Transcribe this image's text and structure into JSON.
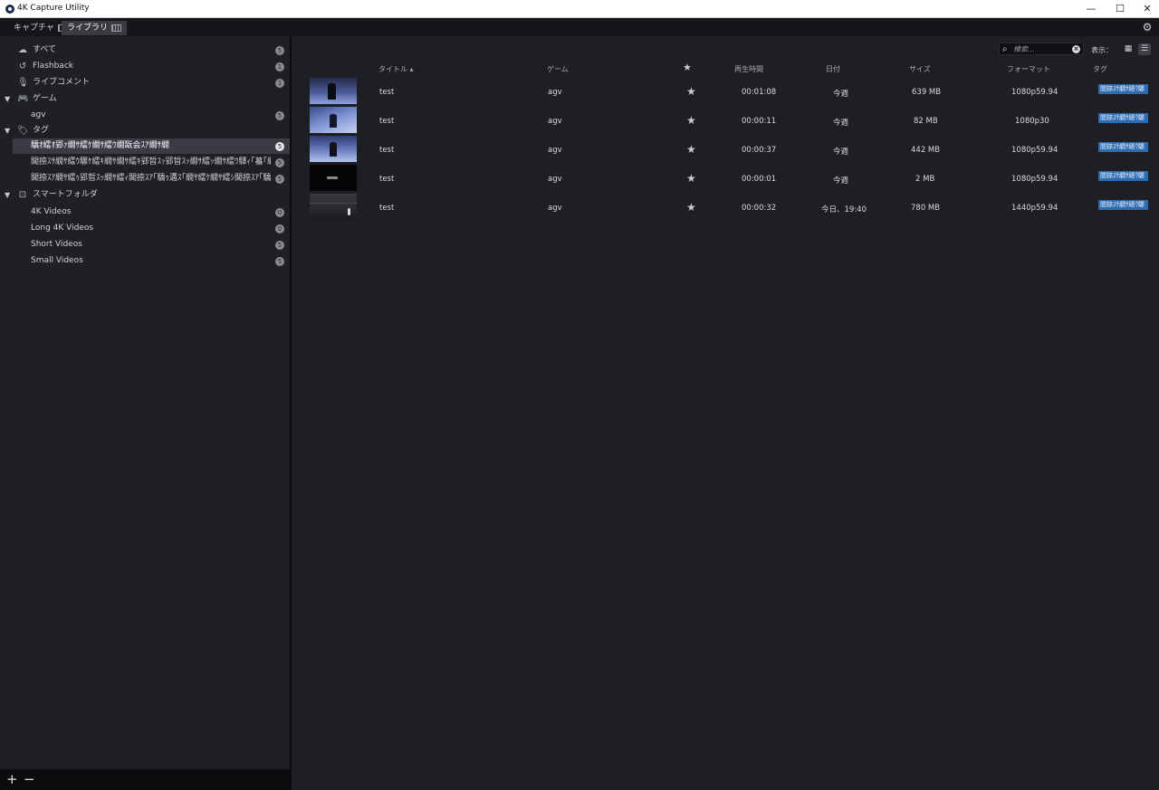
{
  "window": {
    "title": "4K Capture Utility",
    "min": "—",
    "max": "☐",
    "close": "✕"
  },
  "tabs": [
    {
      "label": "キャプチャ"
    },
    {
      "label": "ライブラリ"
    }
  ],
  "sidebar": {
    "items": [
      {
        "label": "すべて",
        "count": "5",
        "icon": "cloud-icon"
      },
      {
        "label": "Flashback",
        "count": "1",
        "icon": "flashback-icon"
      },
      {
        "label": "ライブコメント",
        "count": "1",
        "icon": "mic-icon"
      },
      {
        "label": "ゲーム",
        "icon": "gamepad-icon"
      },
      {
        "label": "agv",
        "count": "5"
      },
      {
        "label": "タグ",
        "icon": "tag-icon"
      },
      {
        "label": "驕ｵ繧ｵ郢ｧ繝ｻ繧ｹ繝ｻ繧ｳ繝翫会ｽｱ繝ｻ繝",
        "count": "5"
      },
      {
        "label": "閭捺ｽｻ繝ｻ繧ｳ騾ｹ繧ｷ繝ｻ繝ｻ繧ｷ郢晢ｽｯ郢晢ｽｯ繝ｻ繧ｯ繝ｻ繧ｳ驛ｨ｢蟇｢繝ｻ繧ｹ繝ｻ繧",
        "count": "5"
      },
      {
        "label": "閭捺ｽｱ繝ｻ繧ｩ郢晢ｽｯ繝ｻ繧ｨ閭捺ｽｱ｢驕ｩ遘ｽ｢繝ｻ繧ｹ繝ｻ繧ｼ閭捺ｽｱ｢驕ｩ遘ｽ｢繝ｻ繧ｼ｣繝ｻ繧",
        "count": "5"
      },
      {
        "label": "スマートフォルダ",
        "icon": "smart-folder-icon"
      },
      {
        "label": "4K Videos",
        "count": "0"
      },
      {
        "label": "Long 4K Videos",
        "count": "0"
      },
      {
        "label": "Short Videos",
        "count": "5"
      },
      {
        "label": "Small Videos",
        "count": "5"
      }
    ],
    "add": "+",
    "remove": "−"
  },
  "toolbar": {
    "search_placeholder": "検索...",
    "view_label": "表示："
  },
  "columns": {
    "title": "タイトル",
    "game": "ゲーム",
    "duration": "再生時間",
    "date": "日付",
    "size": "サイズ",
    "format": "フォーマット",
    "tag": "タグ"
  },
  "rows": [
    {
      "title": "test",
      "game": "agv",
      "duration": "00:01:08",
      "date": "今週",
      "size": "639 MB",
      "format": "1080p59.94",
      "tag": "閭捺ｽｻ繝ｻ繧ｳ騾"
    },
    {
      "title": "test",
      "game": "agv",
      "duration": "00:00:11",
      "date": "今週",
      "size": "82 MB",
      "format": "1080p30",
      "tag": "閭捺ｽｻ繝ｻ繧ｳ騾"
    },
    {
      "title": "test",
      "game": "agv",
      "duration": "00:00:37",
      "date": "今週",
      "size": "442 MB",
      "format": "1080p59.94",
      "tag": "閭捺ｽｻ繝ｻ繧ｳ騾"
    },
    {
      "title": "test",
      "game": "agv",
      "duration": "00:00:01",
      "date": "今週",
      "size": "2 MB",
      "format": "1080p59.94",
      "tag": "閭捺ｽｻ繝ｻ繧ｳ騾"
    },
    {
      "title": "test",
      "game": "agv",
      "duration": "00:00:32",
      "date": "今日、19:40",
      "size": "780 MB",
      "format": "1440p59.94",
      "tag": "閭捺ｽｻ繝ｻ繧ｳ騾"
    }
  ],
  "colors": {
    "tag_bg": "#2d6bb0",
    "selected_bg": "#3a3b44",
    "background": "#1e1f25"
  }
}
